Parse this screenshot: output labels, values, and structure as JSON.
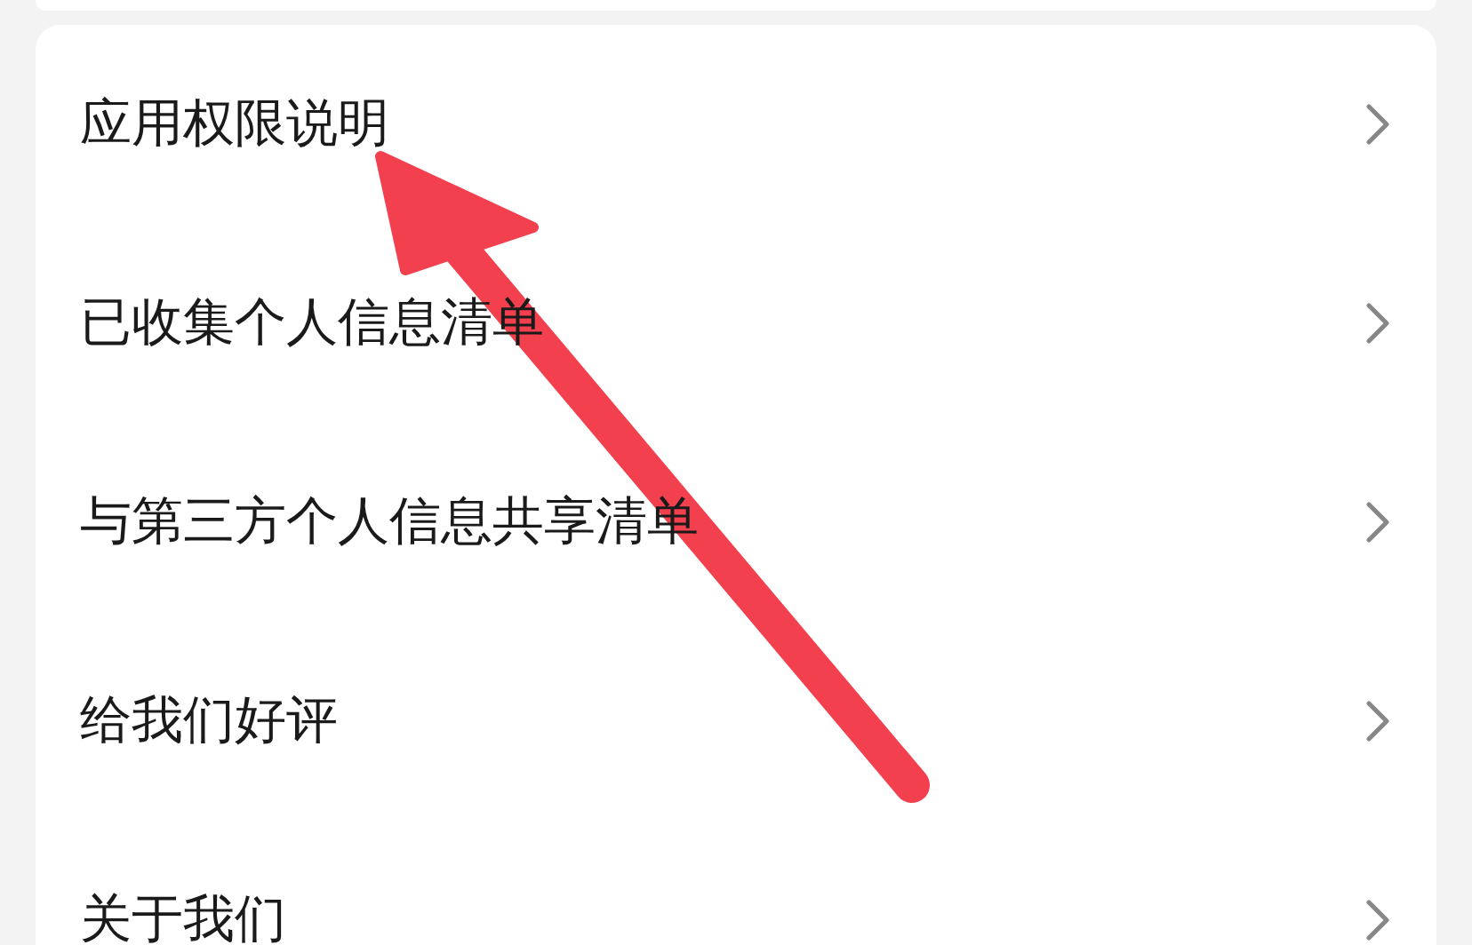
{
  "menu_items": [
    {
      "label": "应用权限说明"
    },
    {
      "label": "已收集个人信息清单"
    },
    {
      "label": "与第三方个人信息共享清单"
    },
    {
      "label": "给我们好评"
    },
    {
      "label": "关于我们"
    }
  ],
  "annotation": {
    "kind": "arrow"
  }
}
